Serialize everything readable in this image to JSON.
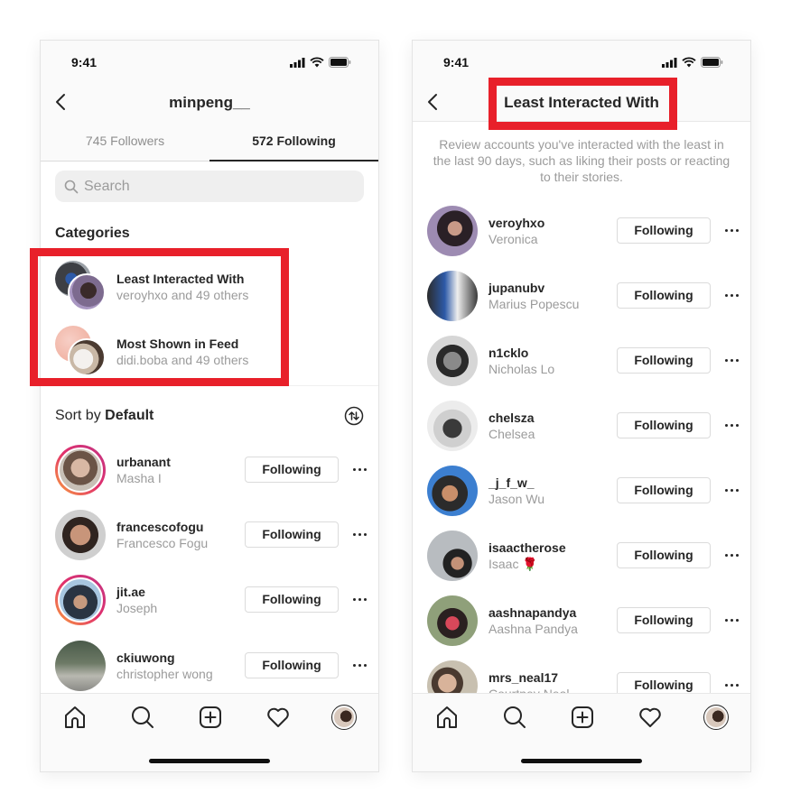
{
  "left_screen": {
    "status_bar": {
      "time": "9:41",
      "icons": [
        "signal-icon",
        "wifi-icon",
        "battery-icon"
      ]
    },
    "nav": {
      "title": "minpeng__",
      "back_icon": "chevron-left-icon"
    },
    "tabs": [
      {
        "label": "745 Followers",
        "active": false
      },
      {
        "label": "572 Following",
        "active": true
      }
    ],
    "search": {
      "placeholder": "Search",
      "value": ""
    },
    "categories": {
      "heading": "Categories",
      "items": [
        {
          "title": "Least Interacted With",
          "subtitle": "veroyhxo and 49 others"
        },
        {
          "title": "Most Shown in Feed",
          "subtitle": "didi.boba and 49 others"
        }
      ]
    },
    "sort": {
      "prefix": "Sort by ",
      "value": "Default",
      "icon": "sort-icon"
    },
    "users": [
      {
        "username": "urbanant",
        "full_name": "Masha I",
        "button": "Following",
        "story_ring": true
      },
      {
        "username": "francescofogu",
        "full_name": "Francesco Fogu",
        "button": "Following",
        "story_ring": false
      },
      {
        "username": "jit.ae",
        "full_name": "Joseph",
        "button": "Following",
        "story_ring": true
      },
      {
        "username": "ckiuwong",
        "full_name": "christopher wong",
        "button": "Following",
        "story_ring": false
      }
    ]
  },
  "right_screen": {
    "status_bar": {
      "time": "9:41",
      "icons": [
        "signal-icon",
        "wifi-icon",
        "battery-icon"
      ]
    },
    "nav": {
      "title": "Least Interacted With",
      "back_icon": "chevron-left-icon"
    },
    "description": "Review accounts you've interacted with the least in the last 90 days, such as liking their posts or reacting to their stories.",
    "users": [
      {
        "username": "veroyhxo",
        "full_name": "Veronica",
        "button": "Following"
      },
      {
        "username": "jupanubv",
        "full_name": "Marius Popescu",
        "button": "Following"
      },
      {
        "username": "n1cklo",
        "full_name": "Nicholas Lo",
        "button": "Following"
      },
      {
        "username": "chelsza",
        "full_name": "Chelsea",
        "button": "Following"
      },
      {
        "username": "_j_f_w_",
        "full_name": "Jason Wu",
        "button": "Following"
      },
      {
        "username": "isaactherose",
        "full_name": "Isaac 🌹",
        "button": "Following"
      },
      {
        "username": "aashnapandya",
        "full_name": "Aashna Pandya",
        "button": "Following"
      },
      {
        "username": "mrs_neal17",
        "full_name": "Courtney Neal",
        "button": "Following"
      }
    ]
  },
  "tab_bar": {
    "icons": [
      "home-icon",
      "search-icon",
      "new-post-icon",
      "activity-heart-icon",
      "profile-avatar"
    ]
  },
  "colors": {
    "highlight": "#e8202a",
    "text": "#262626",
    "secondary_text": "#9b9b9b",
    "story_ring_start": "#f9a23c",
    "story_ring_end": "#c13584"
  }
}
